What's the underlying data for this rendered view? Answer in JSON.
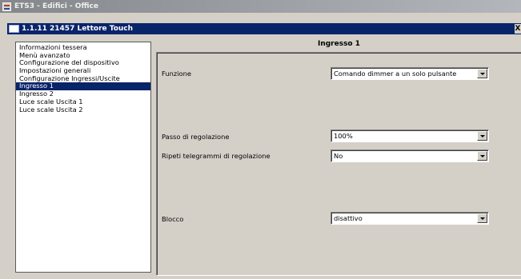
{
  "app": {
    "title": "ETS3 - Edifici - Office"
  },
  "dialog": {
    "title": "1.1.11 21457 Lettore Touch",
    "close_label": "X"
  },
  "sidebar": {
    "items": [
      {
        "label": "Informazioni tessera"
      },
      {
        "label": "Menù avanzato"
      },
      {
        "label": "Configurazione del dispositivo"
      },
      {
        "label": "Impostazioni generali"
      },
      {
        "label": "Configurazione Ingressi/Uscite"
      },
      {
        "label": "Ingresso 1",
        "selected": true
      },
      {
        "label": "Ingresso 2"
      },
      {
        "label": "Luce scale Uscita 1"
      },
      {
        "label": "Luce scale Uscita 2"
      }
    ]
  },
  "main": {
    "title": "Ingresso 1",
    "params": [
      {
        "label": "Funzione",
        "value": "Comando dimmer a un solo pulsante"
      },
      {
        "label": "Passo di regolazione",
        "value": "100%"
      },
      {
        "label": "Ripeti telegrammi di regolazione",
        "value": "No"
      },
      {
        "label": "Blocco",
        "value": "disattivo"
      }
    ]
  },
  "colors": {
    "selection": "#0a246a",
    "window_bg": "#d4d0c8",
    "dialog_titlebar": "#0a246a"
  },
  "icons": {
    "app": "ets-app-icon",
    "dialog": "device-window-icon",
    "dropdown": "chevron-down-icon"
  }
}
